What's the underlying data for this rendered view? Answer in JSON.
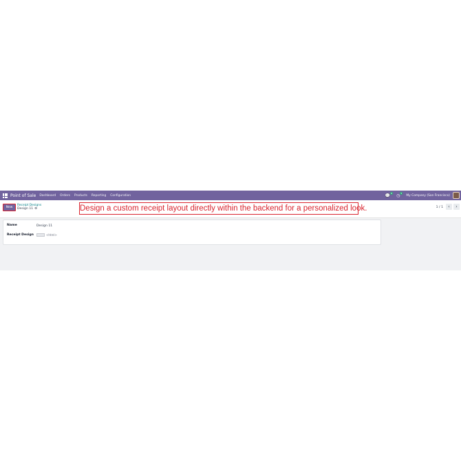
{
  "navbar": {
    "app_title": "Point of Sale",
    "menu": [
      "Dashboard",
      "Orders",
      "Products",
      "Reporting",
      "Configuration"
    ],
    "messages_badge": "6",
    "activities_badge": "5",
    "company": "My Company (San Francisco)"
  },
  "control": {
    "new_label": "New",
    "breadcrumb": "Receipt Designs",
    "record_title": "Design 11",
    "pager": "1 / 1",
    "prev": "‹",
    "next": "›"
  },
  "annotation": "Design a custom receipt layout directly within the backend for a personalized look.",
  "form": {
    "name_label": "Name",
    "name_value": "Design 11",
    "design_label": "Receipt Design",
    "design_value": "<html>"
  },
  "colors": {
    "navbar": "#71639e",
    "annotation": "#d9232e",
    "link": "#017e84"
  }
}
